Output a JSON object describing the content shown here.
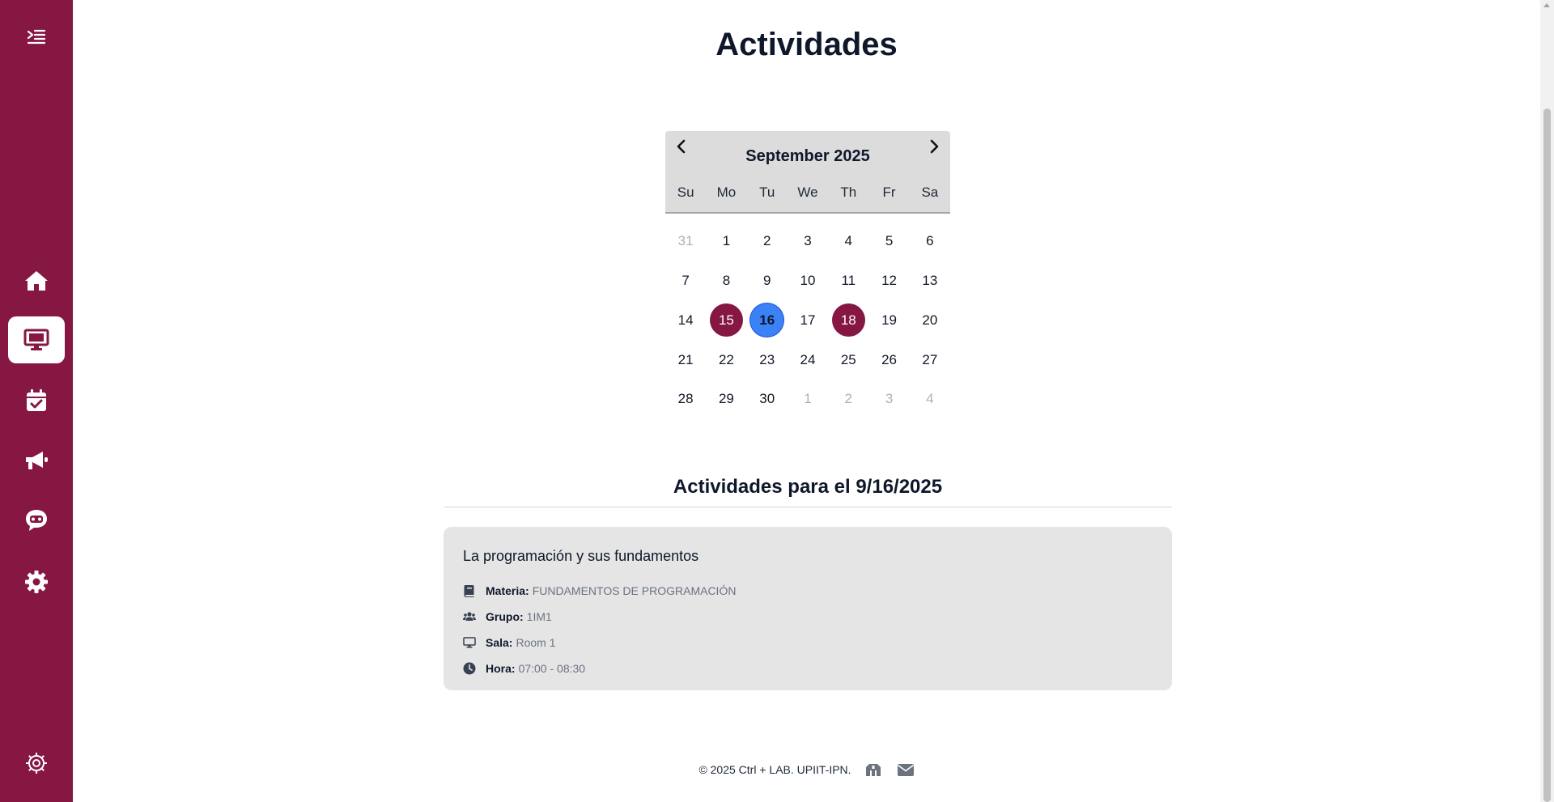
{
  "sidebar": {
    "items": [
      {
        "name": "toggle-menu-icon"
      },
      {
        "name": "home-icon"
      },
      {
        "name": "monitor-icon",
        "active": true
      },
      {
        "name": "calendar-check-icon"
      },
      {
        "name": "megaphone-icon"
      },
      {
        "name": "chatbot-icon"
      },
      {
        "name": "gear-icon"
      },
      {
        "name": "settings-outline-icon"
      }
    ]
  },
  "colors": {
    "brand": "#861742",
    "today": "#3b82f6"
  },
  "page": {
    "title": "Actividades"
  },
  "calendar": {
    "month_label": "September 2025",
    "weekdays": [
      "Su",
      "Mo",
      "Tu",
      "We",
      "Th",
      "Fr",
      "Sa"
    ],
    "days": [
      {
        "label": "31",
        "state": "muted"
      },
      {
        "label": "1"
      },
      {
        "label": "2"
      },
      {
        "label": "3"
      },
      {
        "label": "4"
      },
      {
        "label": "5"
      },
      {
        "label": "6"
      },
      {
        "label": "7"
      },
      {
        "label": "8"
      },
      {
        "label": "9"
      },
      {
        "label": "10"
      },
      {
        "label": "11"
      },
      {
        "label": "12"
      },
      {
        "label": "13"
      },
      {
        "label": "14"
      },
      {
        "label": "15",
        "state": "event"
      },
      {
        "label": "16",
        "state": "today"
      },
      {
        "label": "17"
      },
      {
        "label": "18",
        "state": "event"
      },
      {
        "label": "19"
      },
      {
        "label": "20"
      },
      {
        "label": "21"
      },
      {
        "label": "22"
      },
      {
        "label": "23"
      },
      {
        "label": "24"
      },
      {
        "label": "25"
      },
      {
        "label": "26"
      },
      {
        "label": "27"
      },
      {
        "label": "28"
      },
      {
        "label": "29"
      },
      {
        "label": "30"
      },
      {
        "label": "1",
        "state": "muted"
      },
      {
        "label": "2",
        "state": "muted"
      },
      {
        "label": "3",
        "state": "muted"
      },
      {
        "label": "4",
        "state": "muted"
      }
    ]
  },
  "activities": {
    "heading": "Actividades para el 9/16/2025",
    "card": {
      "title": "La programación y sus fundamentos",
      "rows": [
        {
          "icon": "book-icon",
          "label": "Materia:",
          "value": "FUNDAMENTOS DE PROGRAMACIÓN"
        },
        {
          "icon": "users-icon",
          "label": "Grupo:",
          "value": "1IM1"
        },
        {
          "icon": "monitor-icon",
          "label": "Sala:",
          "value": "Room 1"
        },
        {
          "icon": "clock-icon",
          "label": "Hora:",
          "value": "07:00 - 08:30"
        }
      ]
    }
  },
  "footer": {
    "text": "© 2025 Ctrl + LAB. UPIIT-IPN.",
    "icons": [
      "institution-icon",
      "envelope-icon"
    ]
  }
}
